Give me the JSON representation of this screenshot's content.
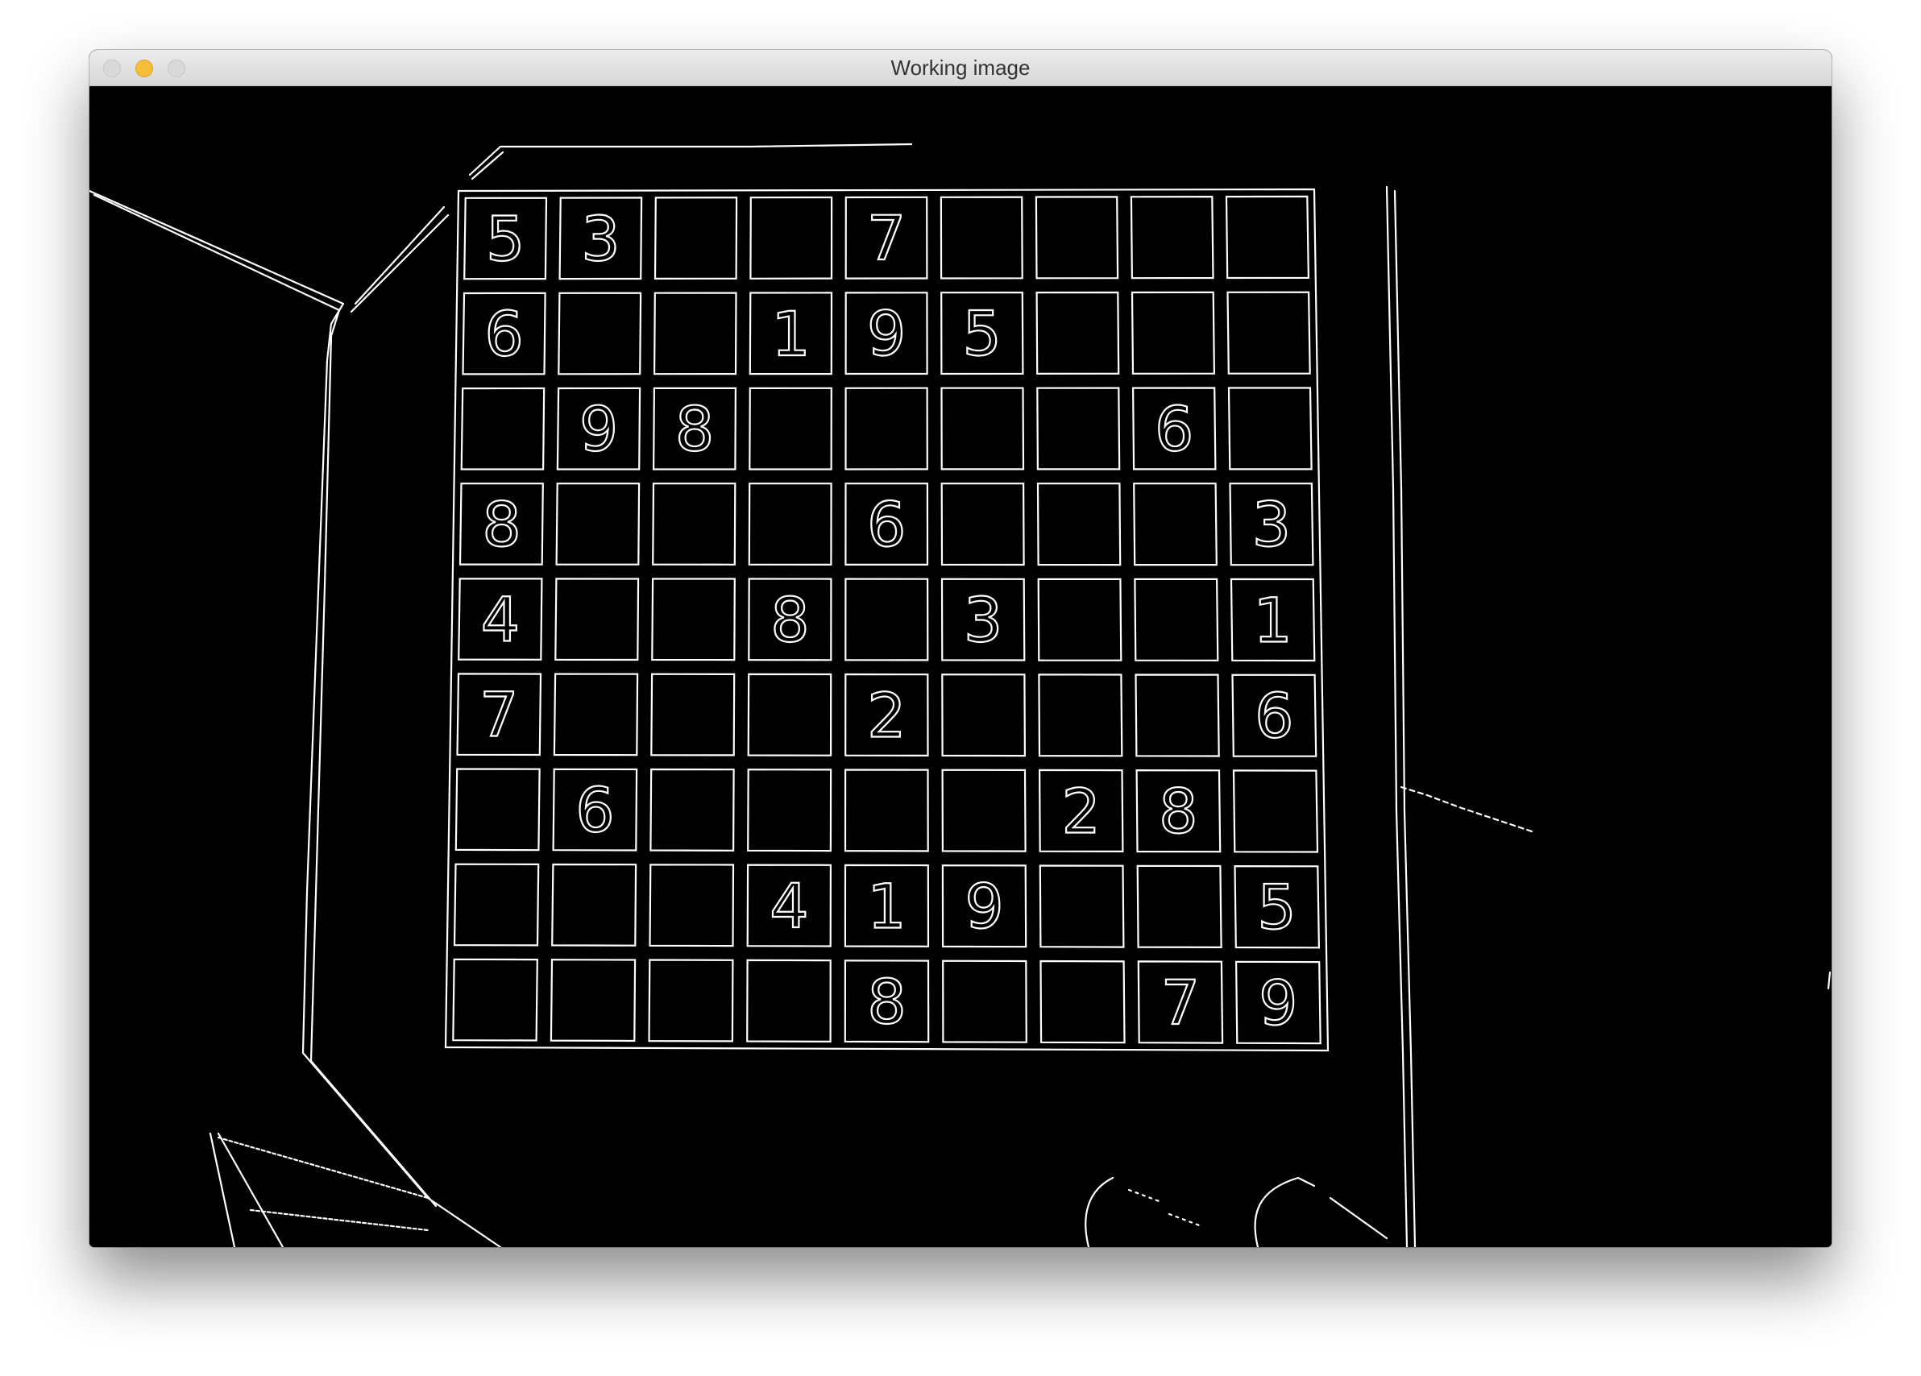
{
  "window": {
    "title": "Working image",
    "accent_colors": {
      "close": "#d9d9d9",
      "minimize": "#f6bd3b",
      "maximize": "#d9d9d9"
    }
  },
  "image": {
    "description_kind": "edge-detected sudoku photo",
    "background": "#000000",
    "line_color": "#ffffff"
  },
  "sudoku": {
    "rows": [
      [
        "5",
        "3",
        "",
        "",
        "7",
        "",
        "",
        "",
        ""
      ],
      [
        "6",
        "",
        "",
        "1",
        "9",
        "5",
        "",
        "",
        ""
      ],
      [
        "",
        "9",
        "8",
        "",
        "",
        "",
        "",
        "6",
        ""
      ],
      [
        "8",
        "",
        "",
        "",
        "6",
        "",
        "",
        "",
        "3"
      ],
      [
        "4",
        "",
        "",
        "8",
        "",
        "3",
        "",
        "",
        "1"
      ],
      [
        "7",
        "",
        "",
        "",
        "2",
        "",
        "",
        "",
        "6"
      ],
      [
        "",
        "6",
        "",
        "",
        "",
        "",
        "2",
        "8",
        ""
      ],
      [
        "",
        "",
        "",
        "4",
        "1",
        "9",
        "",
        "",
        "5"
      ],
      [
        "",
        "",
        "",
        "",
        "8",
        "",
        "",
        "7",
        "9"
      ]
    ]
  }
}
